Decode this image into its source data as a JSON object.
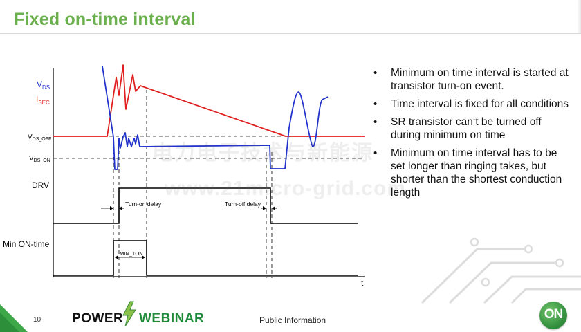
{
  "slide": {
    "title": "Fixed on-time interval",
    "page_number": "10",
    "classification": "Public Information"
  },
  "diagram": {
    "labels": {
      "vds": "V",
      "vds_sub": "DS",
      "isec": "I",
      "isec_sub": "SEC",
      "vds_off": "V",
      "vds_off_sub": "DS_OFF",
      "vds_on": "V",
      "vds_on_sub": "DS_ON",
      "drv": "DRV",
      "min_on_time": "Min ON-time",
      "turn_on_delay": "Turn-on delay",
      "turn_off_delay": "Turn-off delay",
      "min_ton": "MIN_TON",
      "t_axis": "t"
    },
    "colors": {
      "vds": "#2233cc",
      "isec": "#e02020",
      "axis": "#000000"
    }
  },
  "bullets": [
    "Minimum on time interval is started at transistor turn-on event.",
    "Time interval is fixed for all conditions",
    "SR transistor can‘t be turned off during minimum on time",
    "Minimum on time interval has to be set longer than ringing takes, but shorter than the shortest conduction length"
  ],
  "watermark": {
    "line1": "电力电子技术与新能源",
    "line2": "www.21micro-grid.com"
  },
  "footer": {
    "logo_left": "POWER",
    "logo_right": "WEBINAR",
    "brand_logo": "ON",
    "brand_colors": {
      "green": "#2e8b3a",
      "title_green": "#6ab04c"
    }
  }
}
